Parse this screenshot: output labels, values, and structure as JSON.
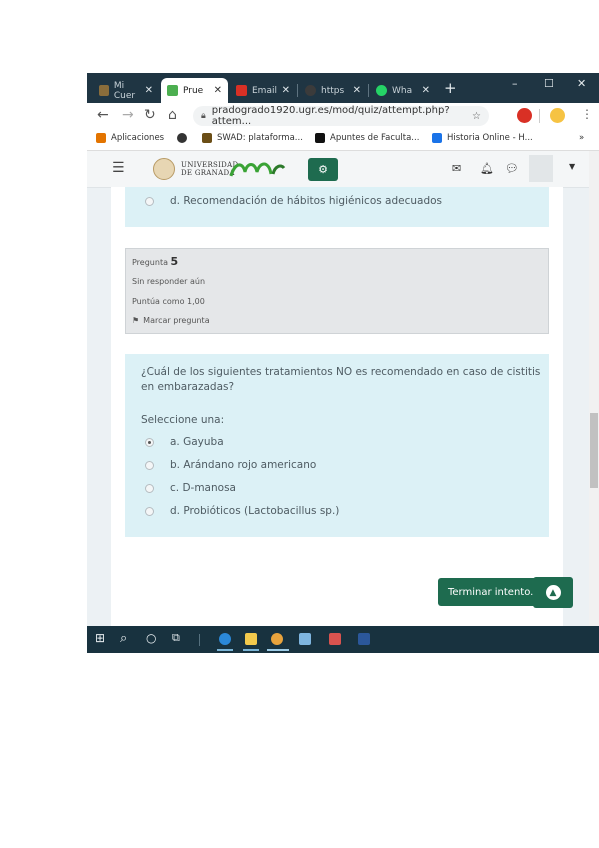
{
  "tabs": [
    {
      "label": "Mi Cuer",
      "favicon_color": "#8a6d3b"
    },
    {
      "label": "Prue",
      "favicon_color": "#4caf50"
    },
    {
      "label": "Email",
      "favicon_color": "#d93025"
    },
    {
      "label": "https",
      "favicon_color": "#3b3b3b"
    },
    {
      "label": "Wha",
      "favicon_color": "#25d366"
    }
  ],
  "window": {
    "new_tab": "+",
    "minimize": "–",
    "maximize": "☐",
    "close": "✕"
  },
  "address": {
    "url": "pradogrado1920.ugr.es/mod/quiz/attempt.php?attem..."
  },
  "bookmarks": [
    {
      "label": "Aplicaciones",
      "icon_color": "#e37400"
    },
    {
      "label": "",
      "icon_color": "#333333"
    },
    {
      "label": "SWAD: plataforma...",
      "icon_color": "#6b4e16"
    },
    {
      "label": "Apuntes de Faculta...",
      "icon_color": "#111111"
    },
    {
      "label": "Historia Online - H...",
      "icon_color": "#1a73e8"
    }
  ],
  "bookmarks_more": "»",
  "site": {
    "logo_line1": "UNIVERSIDAD",
    "logo_line2": "DE GRANADA",
    "accent_color": "#1e6b4f"
  },
  "question4": {
    "last_option": "d. Recomendación de hábitos higiénicos adecuados"
  },
  "question5": {
    "label": "Pregunta",
    "number": "5",
    "status": "Sin responder aún",
    "points": "Puntúa como 1,00",
    "flag": "Marcar pregunta",
    "text": "¿Cuál de los siguientes tratamientos NO es recomendado en caso de cistitis en embarazadas?",
    "select_prompt": "Seleccione una:",
    "options": [
      "a. Gayuba",
      "b. Arándano rojo americano",
      "c. D-manosa",
      "d. Probióticos (Lactobacillus sp.)"
    ],
    "selected_index": 0
  },
  "finish_button": "Terminar intento..."
}
